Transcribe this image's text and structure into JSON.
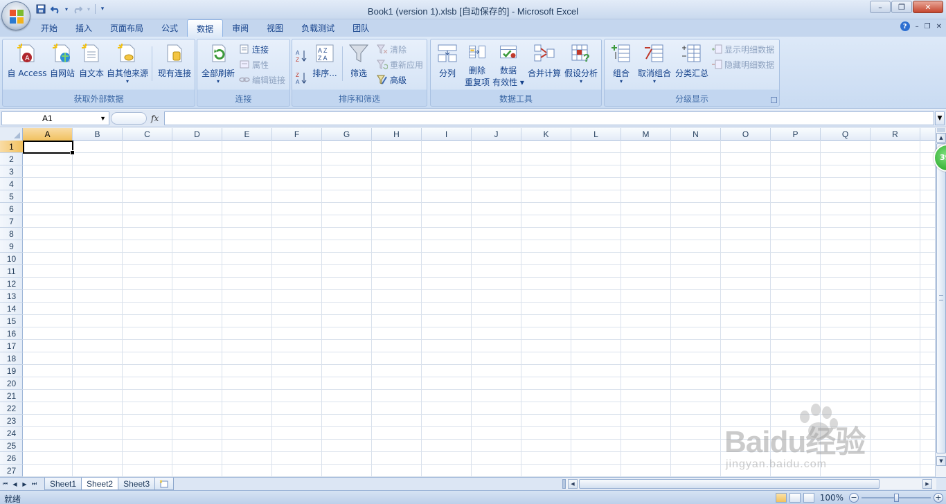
{
  "window": {
    "title": "Book1 (version 1).xlsb [自动保存的] - Microsoft Excel",
    "controls": {
      "minimize": "–",
      "restore": "❐",
      "close": "✕"
    }
  },
  "qat": {
    "save": "save-icon",
    "undo": "undo-icon",
    "redo": "redo-icon",
    "customize": "▾"
  },
  "tabs": [
    {
      "label": "开始"
    },
    {
      "label": "插入"
    },
    {
      "label": "页面布局"
    },
    {
      "label": "公式"
    },
    {
      "label": "数据",
      "active": true
    },
    {
      "label": "审阅"
    },
    {
      "label": "视图"
    },
    {
      "label": "负载测试"
    },
    {
      "label": "团队"
    }
  ],
  "ribbon": {
    "groups": {
      "external": {
        "label": "获取外部数据",
        "access": "自 Access",
        "web": "自网站",
        "text": "自文本",
        "other": "自其他来源",
        "existing": "现有连接"
      },
      "connections": {
        "label": "连接",
        "refresh_all": "全部刷新",
        "connections": "连接",
        "properties": "属性",
        "edit_links": "编辑链接"
      },
      "sort_filter": {
        "label": "排序和筛选",
        "sort": "排序...",
        "filter": "筛选",
        "clear": "清除",
        "reapply": "重新应用",
        "advanced": "高级"
      },
      "data_tools": {
        "label": "数据工具",
        "text_to_columns": "分列",
        "remove_dup_1": "删除",
        "remove_dup_2": "重复项",
        "validation_1": "数据",
        "validation_2": "有效性",
        "consolidate": "合并计算",
        "what_if": "假设分析"
      },
      "outline": {
        "label": "分级显示",
        "group": "组合",
        "ungroup": "取消组合",
        "subtotal": "分类汇总",
        "show_detail": "显示明细数据",
        "hide_detail": "隐藏明细数据"
      }
    }
  },
  "formula_bar": {
    "name_box": "A1",
    "fx": "fx",
    "value": ""
  },
  "columns": [
    "A",
    "B",
    "C",
    "D",
    "E",
    "F",
    "G",
    "H",
    "I",
    "J",
    "K",
    "L",
    "M",
    "N",
    "O",
    "P",
    "Q",
    "R"
  ],
  "rows": [
    "1",
    "2",
    "3",
    "4",
    "5",
    "6",
    "7",
    "8",
    "9",
    "10",
    "11",
    "12",
    "13",
    "14",
    "15",
    "16",
    "17",
    "18",
    "19",
    "20",
    "21",
    "22",
    "23",
    "24",
    "25",
    "26",
    "27"
  ],
  "active_cell": "A1",
  "sheets": [
    {
      "name": "Sheet1"
    },
    {
      "name": "Sheet2",
      "active": true
    },
    {
      "name": "Sheet3"
    }
  ],
  "status": {
    "ready": "就绪",
    "zoom": "100%"
  },
  "badge": "39",
  "watermark": {
    "logo": "Baidu经验",
    "url": "jingyan.baidu.com"
  }
}
